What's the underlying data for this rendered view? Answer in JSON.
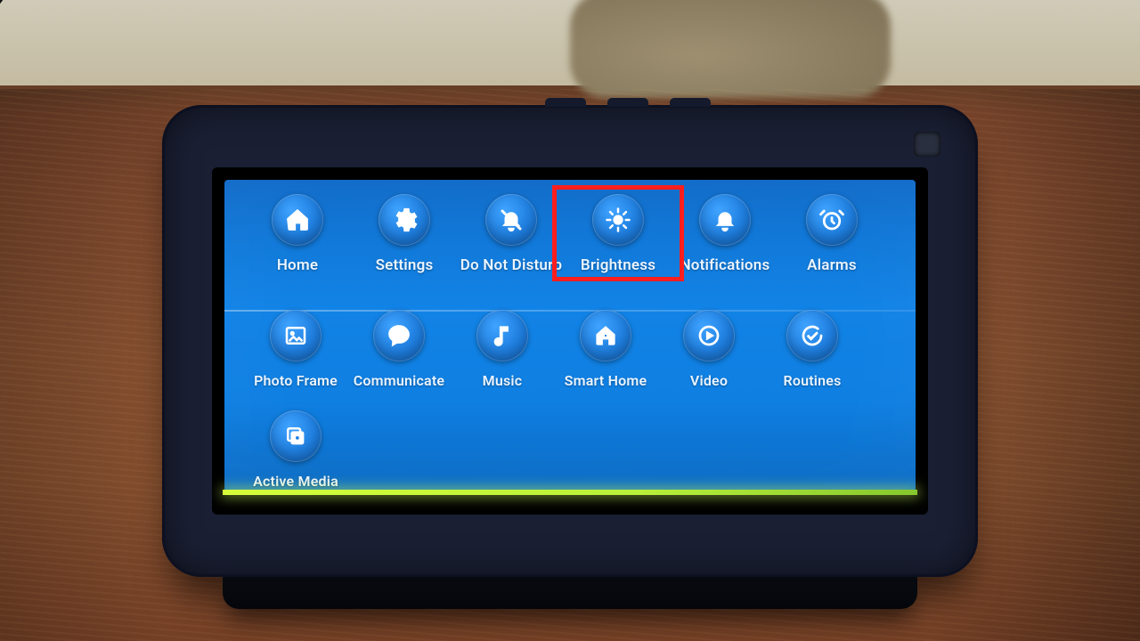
{
  "colors": {
    "panel_top": "#0f6ac8",
    "panel_bottom": "#0b6ac2",
    "tile_bg": "#1f7fe0",
    "text": "#eaf4ff",
    "scanline": "#c8ff3a",
    "highlight": "#ff1e1e"
  },
  "highlight_target": "brightness",
  "rows": [
    [
      {
        "id": "home",
        "label": "Home",
        "icon": "home-icon"
      },
      {
        "id": "settings",
        "label": "Settings",
        "icon": "gear-icon"
      },
      {
        "id": "dnd",
        "label": "Do Not Disturb",
        "icon": "dnd-icon"
      },
      {
        "id": "brightness",
        "label": "Brightness",
        "icon": "sun-icon"
      },
      {
        "id": "notifications",
        "label": "Notifications",
        "icon": "bell-icon"
      },
      {
        "id": "alarms",
        "label": "Alarms",
        "icon": "clock-icon"
      }
    ],
    [
      {
        "id": "photoframe",
        "label": "Photo Frame",
        "icon": "image-icon"
      },
      {
        "id": "communicate",
        "label": "Communicate",
        "icon": "speech-icon"
      },
      {
        "id": "music",
        "label": "Music",
        "icon": "note-icon"
      },
      {
        "id": "smarthome",
        "label": "Smart Home",
        "icon": "smarthome-icon"
      },
      {
        "id": "video",
        "label": "Video",
        "icon": "play-icon"
      },
      {
        "id": "routines",
        "label": "Routines",
        "icon": "check-circle-icon"
      }
    ],
    [
      {
        "id": "activemedia",
        "label": "Active Media",
        "icon": "media-stack-icon"
      }
    ]
  ]
}
